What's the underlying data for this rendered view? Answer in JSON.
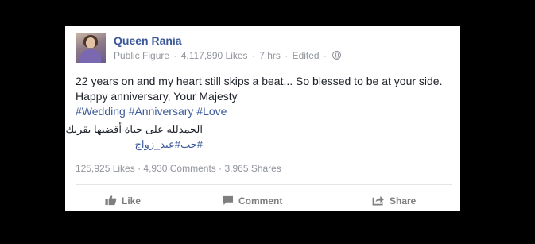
{
  "post": {
    "author": "Queen Rania",
    "category": "Public Figure",
    "likes_count": "4,117,890 Likes",
    "time": "7 hrs",
    "edited": "Edited",
    "line1": "22 years on and my heart still skips a beat... So blessed to be at your side.",
    "line2": "Happy anniversary, Your Majesty",
    "hashtags": [
      "#Wedding",
      "#Anniversary",
      "#Love"
    ],
    "arabic_line": "الحمدلله على حياة أقضيها بقربك",
    "arabic_hashtags": [
      "#حب",
      "#عيد_زواج"
    ]
  },
  "stats": {
    "likes": "125,925 Likes",
    "comments": "4,930 Comments",
    "shares": "3,965 Shares"
  },
  "actions": {
    "like": "Like",
    "comment": "Comment",
    "share": "Share"
  },
  "icons": {
    "like": "thumbs-up-icon",
    "comment": "speech-bubble-icon",
    "share": "share-arrow-icon",
    "privacy": "globe-icon"
  },
  "colors": {
    "background": "#000000",
    "card": "#ffffff",
    "link": "#3b5998",
    "meta": "#90949c",
    "action": "#7f7f7f"
  }
}
